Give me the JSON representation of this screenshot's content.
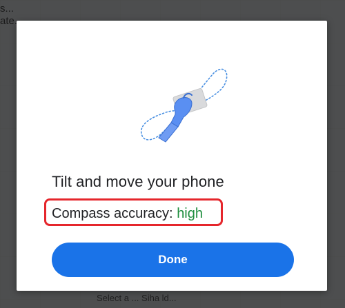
{
  "background": {
    "snippet_lines": [
      "s...",
      "ate..."
    ],
    "bottom_text": "Select a ...   Siha ld..."
  },
  "dialog": {
    "illustration_icon": "tilt-phone-figure-eight-icon",
    "title": "Tilt and move your phone",
    "accuracy_label": "Compass accuracy:",
    "accuracy_value": "high",
    "done_label": "Done"
  },
  "colors": {
    "accent": "#1a73e8",
    "accuracy_value": "#1e8e3e",
    "highlight_border": "#e5262c"
  }
}
